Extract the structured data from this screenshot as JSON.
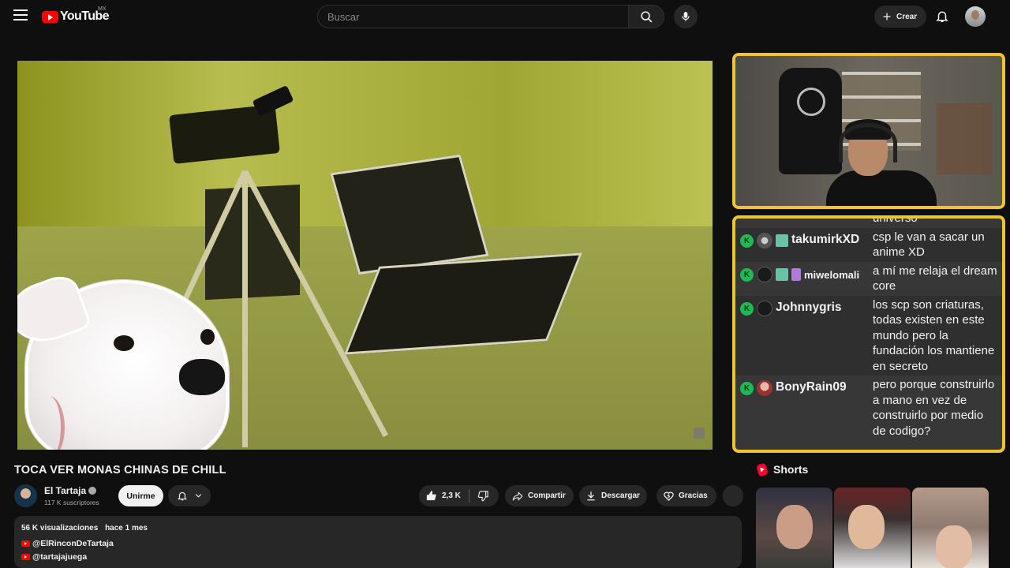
{
  "header": {
    "logo_text": "YouTube",
    "country": "MX",
    "search_placeholder": "Buscar",
    "create_label": "Crear"
  },
  "video": {
    "title": "TOCA VER MONAS CHINAS DE CHILL"
  },
  "channel": {
    "name": "El Tartaja",
    "subscribers": "117 K suscriptores",
    "join_label": "Unirme"
  },
  "actions": {
    "likes": "2,3 K",
    "share": "Compartir",
    "download": "Descargar",
    "thanks": "Gracias"
  },
  "description": {
    "views": "56 K visualizaciones",
    "date": "hace 1 mes",
    "links": [
      "@ElRinconDeTartaja",
      "@tartajajuega"
    ]
  },
  "chat": {
    "messages": [
      {
        "user": "",
        "text": "universo"
      },
      {
        "user": "takumirkXD",
        "text": "csp le van a sacar un anime XD"
      },
      {
        "user": "miwelomali",
        "text": "a mí me relaja el dream core"
      },
      {
        "user": "Johnnygris",
        "text": "los scp son criaturas, todas existen en este mundo pero la fundación los mantiene en secreto"
      },
      {
        "user": "BonyRain09",
        "text": "pero porque construirlo a mano en vez de construirlo por medio de codigo?"
      }
    ]
  },
  "shorts": {
    "title": "Shorts"
  },
  "colors": {
    "accent_frame": "#f0c330",
    "youtube_red": "#ff0000",
    "badge_green": "#1db954"
  }
}
